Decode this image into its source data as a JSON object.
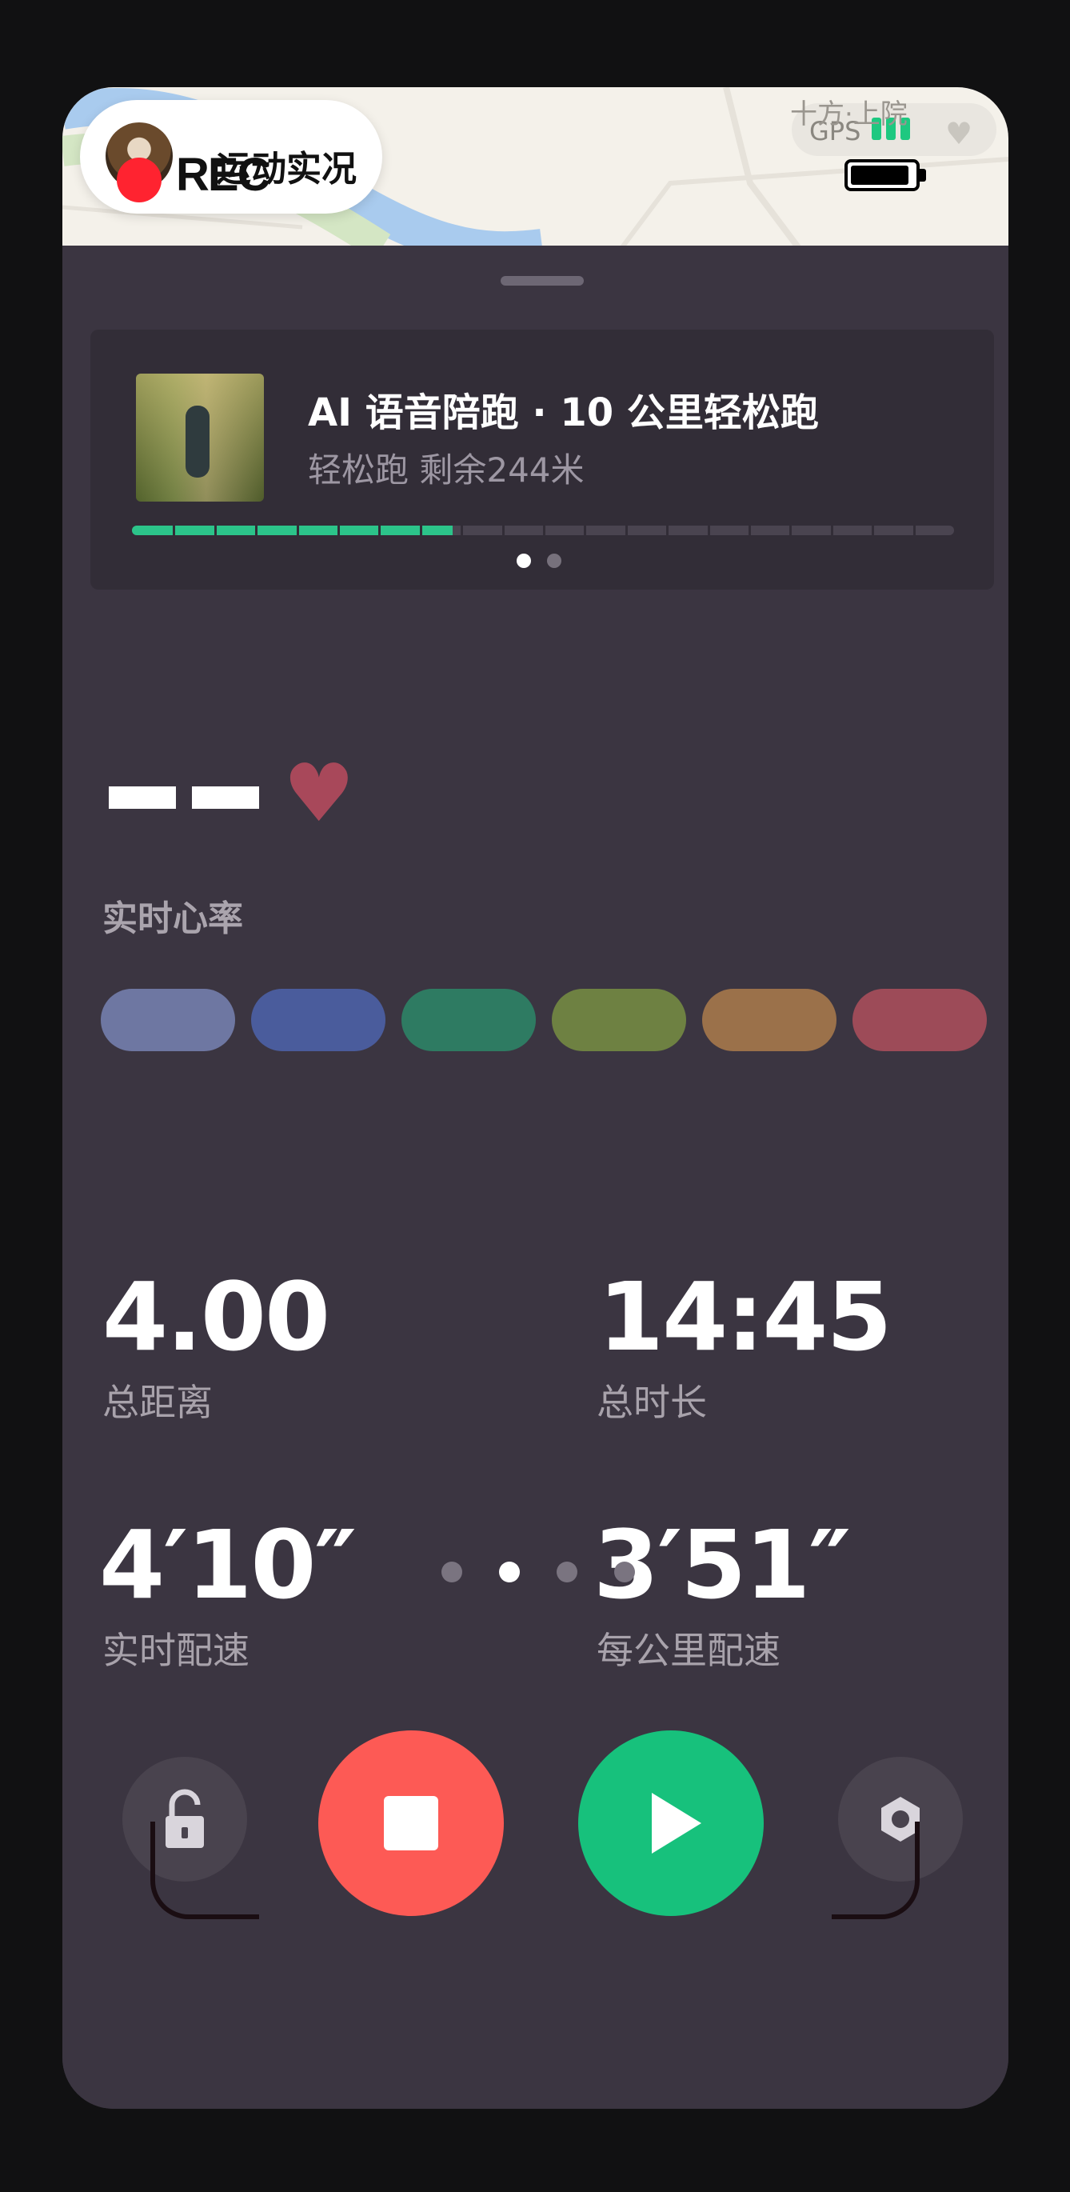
{
  "header": {
    "live_title": "运动实况",
    "rec_label": "REC",
    "location_text": "十方·上院",
    "gps_label": "GPS",
    "gps_signal_bars": 3,
    "heart_icon": "heart-icon"
  },
  "course": {
    "title": "AI 语音陪跑 · 10 公里轻松跑",
    "subtitle": "轻松跑 剩余244米",
    "progress": 0.39,
    "segments": 20,
    "card_page": 1,
    "card_pages": 2
  },
  "heart_rate": {
    "value": "--",
    "label": "实时心率",
    "zone_colors": [
      "#6e77a2",
      "#4a5c9c",
      "#2e7b62",
      "#6e8142",
      "#9b714a",
      "#9d4b58"
    ]
  },
  "stats": {
    "distance": {
      "value": "4.00",
      "label": "总距离"
    },
    "duration": {
      "value": "14:45",
      "label": "总时长"
    },
    "pace_live": {
      "value": "4′10″",
      "label": "实时配速"
    },
    "pace_km": {
      "value": "3′51″",
      "label": "每公里配速"
    }
  },
  "pager": {
    "count": 4,
    "active": 1
  },
  "controls": {
    "lock": "lock-icon",
    "stop": "stop-icon",
    "play": "play-icon",
    "settings": "settings-icon"
  },
  "colors": {
    "accent_green": "#17c17c",
    "stop_red": "#fd5a55",
    "background": "#3b3541"
  }
}
